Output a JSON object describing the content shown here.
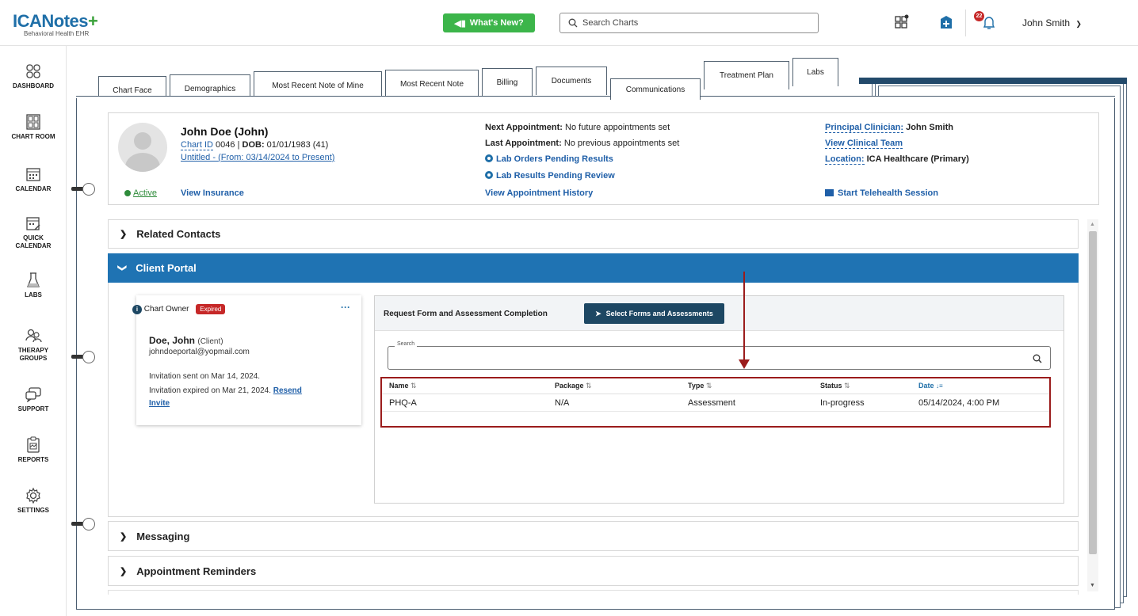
{
  "app": {
    "logo": "ICANotes",
    "logo_plus": "+",
    "logo_sub": "Behavioral Health EHR"
  },
  "header": {
    "whats_new": "What's New?",
    "search_placeholder": "Search Charts",
    "notification_count": "22",
    "user_name": "John Smith"
  },
  "sidebar": {
    "items": [
      {
        "label": "DASHBOARD",
        "icon": "dashboard-icon"
      },
      {
        "label": "CHART ROOM",
        "icon": "chart-room-icon"
      },
      {
        "label": "CALENDAR",
        "icon": "calendar-icon"
      },
      {
        "label": "QUICK CALENDAR",
        "label1": "QUICK",
        "label2": "CALENDAR",
        "icon": "quick-calendar-icon"
      },
      {
        "label": "LABS",
        "icon": "flask-icon"
      },
      {
        "label": "THERAPY GROUPS",
        "label1": "THERAPY",
        "label2": "GROUPS",
        "icon": "group-icon"
      },
      {
        "label": "SUPPORT",
        "icon": "support-icon"
      },
      {
        "label": "REPORTS",
        "icon": "reports-icon"
      },
      {
        "label": "SETTINGS",
        "icon": "gear-icon"
      }
    ]
  },
  "tabs": [
    {
      "label": "Chart Face"
    },
    {
      "label": "Demographics"
    },
    {
      "label": "Most Recent Note of Mine"
    },
    {
      "label": "Most Recent Note"
    },
    {
      "label": "Billing"
    },
    {
      "label": "Documents"
    },
    {
      "label": "Communications",
      "active": true
    },
    {
      "label": "Treatment Plan"
    },
    {
      "label": "Labs"
    }
  ],
  "patient": {
    "name": "John Doe (John)",
    "chart_id_label": "Chart ID",
    "chart_id": "0046",
    "dob_label": "DOB:",
    "dob": "01/01/1983 (41)",
    "episode": "Untitled - (From: 03/14/2024 to Present)",
    "status": "Active",
    "view_insurance": "View Insurance",
    "next_appt_label": "Next Appointment:",
    "next_appt": "No future appointments set",
    "last_appt_label": "Last Appointment:",
    "last_appt": "No previous appointments set",
    "lab_orders": "Lab Orders Pending Results",
    "lab_results": "Lab Results Pending Review",
    "view_appt_history": "View Appointment History",
    "principal_label": "Principal Clinician:",
    "principal": "John Smith",
    "view_team": "View Clinical Team",
    "location_label": "Location:",
    "location": "ICA Healthcare (Primary)",
    "telehealth": "Start Telehealth Session"
  },
  "sections": {
    "related_contacts": "Related Contacts",
    "client_portal": "Client Portal",
    "messaging": "Messaging",
    "appointment_reminders": "Appointment Reminders"
  },
  "owner": {
    "title": "Chart Owner",
    "status": "Expired",
    "more": "···",
    "name": "Doe, John",
    "role": "(Client)",
    "email": "johndoeportal@yopmail.com",
    "sent": "Invitation sent on Mar 14, 2024.",
    "expired": "Invitation expired on Mar 21, 2024.",
    "resend1": "Resend",
    "resend2": "Invite"
  },
  "request": {
    "title": "Request Form and Assessment Completion",
    "button": "Select Forms and Assessments",
    "search_legend": "Search",
    "columns": [
      "Name",
      "Package",
      "Type",
      "Status",
      "Date"
    ],
    "rows": [
      {
        "name": "PHQ-A",
        "package": "N/A",
        "type": "Assessment",
        "status": "In-progress",
        "date": "05/14/2024, 4:00 PM"
      }
    ]
  },
  "colors": {
    "brand": "#1f6fa8",
    "portal_header": "#1f73b3",
    "highlight": "#9b1c1c",
    "button": "#1d4763",
    "whats_new": "#3cb54a"
  }
}
